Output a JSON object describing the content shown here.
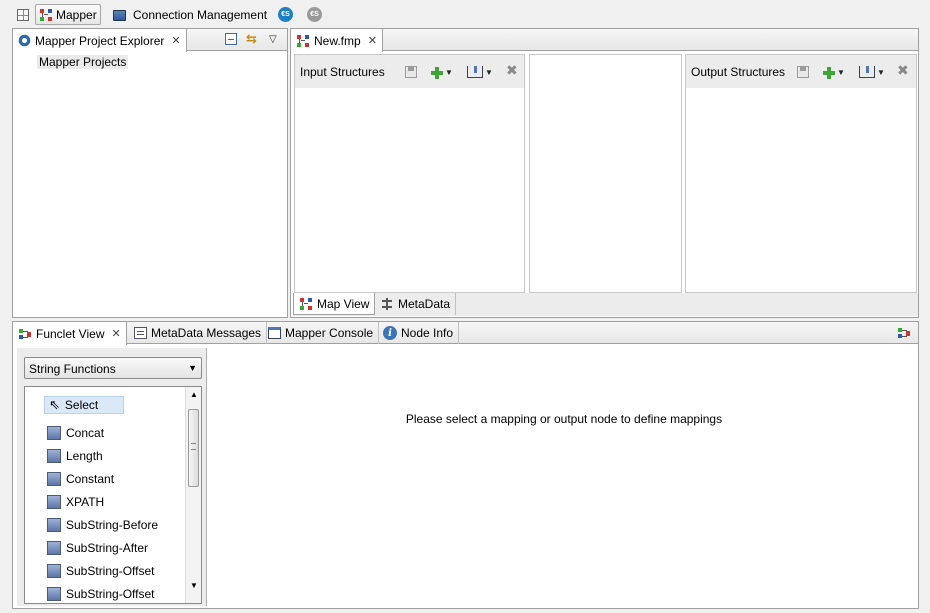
{
  "perspectives": {
    "mapper_label": "Mapper",
    "connection_label": "Connection Management",
    "badge1": "€S",
    "badge2": "€S"
  },
  "explorer": {
    "tab_label": "Mapper Project Explorer",
    "tree_root": "Mapper Projects"
  },
  "editor": {
    "tab_label": "New.fmp",
    "input_title": "Input Structures",
    "output_title": "Output Structures",
    "bottom_tabs": [
      "Map View",
      "MetaData"
    ]
  },
  "bottom": {
    "tabs": [
      "Funclet View",
      "MetaData Messages",
      "Mapper Console",
      "Node Info"
    ],
    "function_select": "String Functions",
    "palette_items": [
      "Select",
      "Concat",
      "Length",
      "Constant",
      "XPATH",
      "SubString-Before",
      "SubString-After",
      "SubString-Offset",
      "SubString-Offset"
    ],
    "message": "Please select a mapping or output node to define mappings"
  }
}
